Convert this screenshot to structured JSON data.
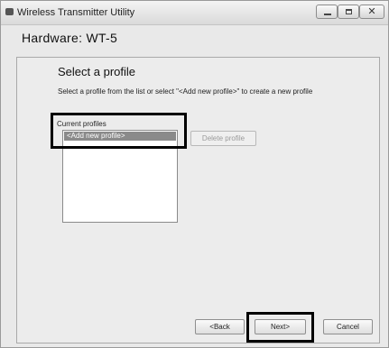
{
  "window": {
    "title": "Wireless Transmitter Utility",
    "controls": {
      "close_glyph": "✕"
    }
  },
  "header": {
    "hardware_title": "Hardware: WT-5"
  },
  "main": {
    "heading": "Select a profile",
    "description": "Select a profile from the list or select \"<Add new profile>\" to create a new profile",
    "profiles_label": "Current profiles",
    "profiles": [
      "<Add new profile>"
    ],
    "delete_label": "Delete profile"
  },
  "footer": {
    "back_label": "<Back",
    "next_label": "Next>",
    "cancel_label": "Cancel"
  },
  "icons": {
    "app": "app-icon",
    "minimize": "minimize-icon",
    "maximize": "maximize-icon",
    "close": "close-icon"
  },
  "colors": {
    "selection": "#8a8a8a",
    "highlight_frame": "#000000"
  }
}
